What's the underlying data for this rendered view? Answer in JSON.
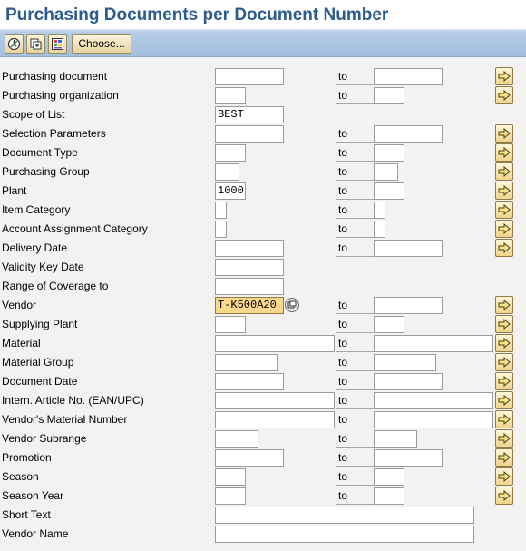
{
  "window": {
    "title": "Purchasing Documents per Document Number"
  },
  "toolbar": {
    "execute_icon": "execute-icon",
    "get_variant_icon": "get-variant-icon",
    "dynamic_selections_icon": "dynamic-selections-icon",
    "choose_label": "Choose..."
  },
  "form": {
    "to_label": "to",
    "rows": [
      {
        "label": "Purchasing document",
        "low": "",
        "high": ""
      },
      {
        "label": "Purchasing organization",
        "low": "",
        "high": ""
      },
      {
        "label": "Scope of List",
        "low": "BEST"
      },
      {
        "label": "Selection Parameters",
        "low": "",
        "high": ""
      },
      {
        "label": "Document Type",
        "low": "",
        "high": ""
      },
      {
        "label": "Purchasing Group",
        "low": "",
        "high": ""
      },
      {
        "label": "Plant",
        "low": "1000",
        "high": ""
      },
      {
        "label": "Item Category",
        "low": "",
        "high": ""
      },
      {
        "label": "Account Assignment Category",
        "low": "",
        "high": ""
      },
      {
        "label": "Delivery Date",
        "low": "",
        "high": ""
      },
      {
        "label": "Validity Key Date",
        "low": ""
      },
      {
        "label": "Range of Coverage to",
        "low": ""
      },
      {
        "label": "Vendor",
        "low": "T-K500A20",
        "high": ""
      },
      {
        "label": "Supplying Plant",
        "low": "",
        "high": ""
      },
      {
        "label": "Material",
        "low": "",
        "high": ""
      },
      {
        "label": "Material Group",
        "low": "",
        "high": ""
      },
      {
        "label": "Document Date",
        "low": "",
        "high": ""
      },
      {
        "label": "Intern. Article No. (EAN/UPC)",
        "low": "",
        "high": ""
      },
      {
        "label": "Vendor's Material Number",
        "low": "",
        "high": ""
      },
      {
        "label": "Vendor Subrange",
        "low": "",
        "high": ""
      },
      {
        "label": "Promotion",
        "low": "",
        "high": ""
      },
      {
        "label": "Season",
        "low": "",
        "high": ""
      },
      {
        "label": "Season Year",
        "low": "",
        "high": ""
      },
      {
        "label": "Short Text",
        "low": ""
      },
      {
        "label": "Vendor Name",
        "low": ""
      }
    ]
  }
}
